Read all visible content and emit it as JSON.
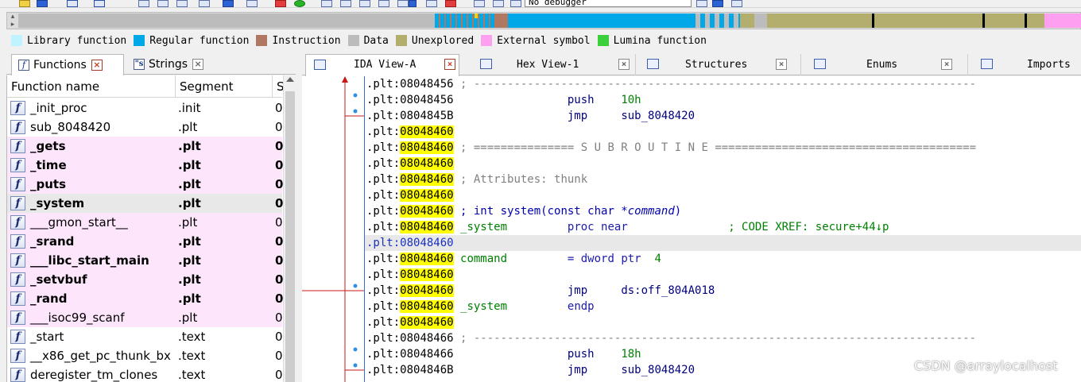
{
  "toolbar": {
    "debugger": "No debugger"
  },
  "legend": [
    {
      "label": "Library function",
      "color": "#bff3ff"
    },
    {
      "label": "Regular function",
      "color": "#00a8e8"
    },
    {
      "label": "Instruction",
      "color": "#b07860"
    },
    {
      "label": "Data",
      "color": "#bcbcbc"
    },
    {
      "label": "Unexplored",
      "color": "#b3ae6e"
    },
    {
      "label": "External symbol",
      "color": "#ff9ff0"
    },
    {
      "label": "Lumina function",
      "color": "#3ccf3c"
    }
  ],
  "left_tabs": {
    "functions": "Functions",
    "strings": "Strings",
    "close_glyph": "×"
  },
  "functions_table": {
    "headers": [
      "Function name",
      "Segment",
      "S"
    ],
    "rows": [
      {
        "name": "_init_proc",
        "segment": ".init",
        "start": "0",
        "bold": false,
        "external": false,
        "selected": false
      },
      {
        "name": "sub_8048420",
        "segment": ".plt",
        "start": "0",
        "bold": false,
        "external": false,
        "selected": false
      },
      {
        "name": "_gets",
        "segment": ".plt",
        "start": "0",
        "bold": true,
        "external": true,
        "selected": false
      },
      {
        "name": "_time",
        "segment": ".plt",
        "start": "0",
        "bold": true,
        "external": true,
        "selected": false
      },
      {
        "name": "_puts",
        "segment": ".plt",
        "start": "0",
        "bold": true,
        "external": true,
        "selected": false
      },
      {
        "name": "_system",
        "segment": ".plt",
        "start": "0",
        "bold": true,
        "external": false,
        "selected": true
      },
      {
        "name": "___gmon_start__",
        "segment": ".plt",
        "start": "0",
        "bold": false,
        "external": true,
        "selected": false
      },
      {
        "name": "_srand",
        "segment": ".plt",
        "start": "0",
        "bold": true,
        "external": true,
        "selected": false
      },
      {
        "name": "___libc_start_main",
        "segment": ".plt",
        "start": "0",
        "bold": true,
        "external": true,
        "selected": false
      },
      {
        "name": "_setvbuf",
        "segment": ".plt",
        "start": "0",
        "bold": true,
        "external": true,
        "selected": false
      },
      {
        "name": "_rand",
        "segment": ".plt",
        "start": "0",
        "bold": true,
        "external": true,
        "selected": false
      },
      {
        "name": "___isoc99_scanf",
        "segment": ".plt",
        "start": "0",
        "bold": false,
        "external": true,
        "selected": false
      },
      {
        "name": "_start",
        "segment": ".text",
        "start": "0",
        "bold": false,
        "external": false,
        "selected": false
      },
      {
        "name": "__x86_get_pc_thunk_bx",
        "segment": ".text",
        "start": "0",
        "bold": false,
        "external": false,
        "selected": false
      },
      {
        "name": "deregister_tm_clones",
        "segment": ".text",
        "start": "0",
        "bold": false,
        "external": false,
        "selected": false
      }
    ]
  },
  "right_tabs": {
    "ida_view": "IDA View-A",
    "hex_view": "Hex View-1",
    "structures": "Structures",
    "enums": "Enums",
    "imports": "Imports",
    "close_glyph": "×"
  },
  "code_lines": [
    {
      "seg": ".plt:",
      "addr": "08048456",
      "yellow": false,
      "blue": false,
      "parts": [
        {
          "c": "cmt",
          "t": " ; ---------------------------------------------------------------------------"
        }
      ]
    },
    {
      "seg": ".plt:",
      "addr": "08048456",
      "yellow": false,
      "blue": false,
      "parts": [
        {
          "c": "mnem",
          "t": "                 push    "
        },
        {
          "c": "opnd-g",
          "t": "10h"
        }
      ]
    },
    {
      "seg": ".plt:",
      "addr": "0804845B",
      "yellow": false,
      "blue": false,
      "parts": [
        {
          "c": "mnem",
          "t": "                 jmp     "
        },
        {
          "c": "opnd-b",
          "t": "sub_8048420"
        }
      ]
    },
    {
      "seg": ".plt:",
      "addr": "08048460",
      "yellow": true,
      "blue": false,
      "parts": []
    },
    {
      "seg": ".plt:",
      "addr": "08048460",
      "yellow": true,
      "blue": false,
      "parts": [
        {
          "c": "cmt",
          "t": " ; =============== S U B R O U T I N E ======================================="
        }
      ]
    },
    {
      "seg": ".plt:",
      "addr": "08048460",
      "yellow": true,
      "blue": false,
      "parts": []
    },
    {
      "seg": ".plt:",
      "addr": "08048460",
      "yellow": true,
      "blue": false,
      "parts": [
        {
          "c": "cmt",
          "t": " ; Attributes: thunk"
        }
      ]
    },
    {
      "seg": ".plt:",
      "addr": "08048460",
      "yellow": true,
      "blue": false,
      "parts": []
    },
    {
      "seg": ".plt:",
      "addr": "08048460",
      "yellow": true,
      "blue": false,
      "parts": [
        {
          "c": "proto-b",
          "t": " ; int system(const char *"
        },
        {
          "c": "proto-b ital",
          "t": "command"
        },
        {
          "c": "proto-b",
          "t": ")"
        }
      ]
    },
    {
      "seg": ".plt:",
      "addr": "08048460",
      "yellow": true,
      "blue": false,
      "parts": [
        {
          "c": "name-g",
          "t": " _system         "
        },
        {
          "c": "kw-b",
          "t": "proc near               "
        },
        {
          "c": "xref",
          "t": "; CODE XREF: secure+44↓p"
        }
      ]
    },
    {
      "seg": ".plt:",
      "addr": "08048460",
      "yellow": false,
      "blue": true,
      "hl": true,
      "parts": []
    },
    {
      "seg": ".plt:",
      "addr": "08048460",
      "yellow": true,
      "blue": false,
      "parts": [
        {
          "c": "name-g",
          "t": " command         "
        },
        {
          "c": "kw-b",
          "t": "= dword ptr  "
        },
        {
          "c": "opnd-g",
          "t": "4"
        }
      ]
    },
    {
      "seg": ".plt:",
      "addr": "08048460",
      "yellow": true,
      "blue": false,
      "parts": []
    },
    {
      "seg": ".plt:",
      "addr": "08048460",
      "yellow": true,
      "blue": false,
      "parts": [
        {
          "c": "mnem",
          "t": "                 jmp     "
        },
        {
          "c": "opnd-b",
          "t": "ds:off_804A018"
        }
      ]
    },
    {
      "seg": ".plt:",
      "addr": "08048460",
      "yellow": true,
      "blue": false,
      "parts": [
        {
          "c": "name-g",
          "t": " _system         "
        },
        {
          "c": "kw-b",
          "t": "endp"
        }
      ]
    },
    {
      "seg": ".plt:",
      "addr": "08048460",
      "yellow": true,
      "blue": false,
      "parts": []
    },
    {
      "seg": ".plt:",
      "addr": "08048466",
      "yellow": false,
      "blue": false,
      "parts": [
        {
          "c": "cmt",
          "t": " ; ---------------------------------------------------------------------------"
        }
      ]
    },
    {
      "seg": ".plt:",
      "addr": "08048466",
      "yellow": false,
      "blue": false,
      "parts": [
        {
          "c": "mnem",
          "t": "                 push    "
        },
        {
          "c": "opnd-g",
          "t": "18h"
        }
      ]
    },
    {
      "seg": ".plt:",
      "addr": "0804846B",
      "yellow": false,
      "blue": false,
      "parts": [
        {
          "c": "mnem",
          "t": "                 jmp     "
        },
        {
          "c": "opnd-b",
          "t": "sub_8048420"
        }
      ]
    }
  ],
  "watermark": "CSDN @arraylocalhost"
}
